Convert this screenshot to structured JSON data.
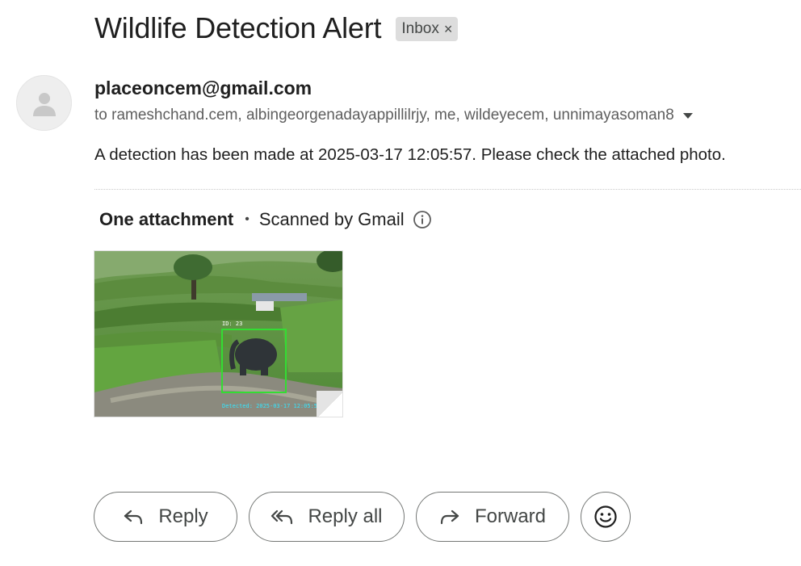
{
  "email": {
    "subject": "Wildlife Detection Alert",
    "label": "Inbox",
    "label_close": "×",
    "sender": "placeoncem@gmail.com",
    "recipients": "to rameshchand.cem, albingeorgenadayappillilrjy, me, wildeyecem, unnimayasoman8",
    "body": "A detection has been made at 2025-03-17 12:05:57. Please check the attached photo."
  },
  "attachments": {
    "count_label": "One attachment",
    "separator": "•",
    "scanned_label": "Scanned by Gmail",
    "thumbnail": {
      "box_label": "ID: 23",
      "timestamp_overlay": "Detected: 2025-03-17 12:05:57",
      "box_color": "#33dd33",
      "overlay_text_color": "#33e6ff"
    }
  },
  "actions": {
    "reply": "Reply",
    "reply_all": "Reply all",
    "forward": "Forward",
    "emoji_icon": "smiley-icon"
  },
  "colors": {
    "label_chip_bg": "#dddddd",
    "secondary_text": "#5e5e5e",
    "button_border": "#747775"
  }
}
